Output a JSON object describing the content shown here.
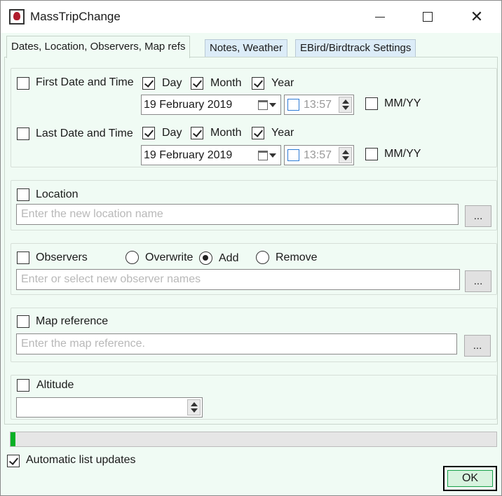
{
  "window": {
    "title": "MassTripChange",
    "background": "#f0fbf4"
  },
  "tabs": [
    {
      "label": "Dates, Location, Observers, Map refs",
      "active": true
    },
    {
      "label": "Notes, Weather",
      "active": false
    },
    {
      "label": "EBird/Birdtrack Settings",
      "active": false
    }
  ],
  "dates": {
    "first": {
      "label": "First Date and Time",
      "checked": false,
      "day_label": "Day",
      "day_checked": true,
      "month_label": "Month",
      "month_checked": true,
      "year_label": "Year",
      "year_checked": true,
      "date_value": "19  February  2019",
      "time_value": "13:57",
      "mmyy_label": "MM/YY",
      "mmyy_checked": false
    },
    "last": {
      "label": "Last Date and Time",
      "checked": false,
      "day_label": "Day",
      "day_checked": true,
      "month_label": "Month",
      "month_checked": true,
      "year_label": "Year",
      "year_checked": true,
      "date_value": "19  February  2019",
      "time_value": "13:57",
      "mmyy_label": "MM/YY",
      "mmyy_checked": false
    }
  },
  "location": {
    "label": "Location",
    "checked": false,
    "placeholder": "Enter the new location name",
    "browse_label": "..."
  },
  "observers": {
    "label": "Observers",
    "checked": false,
    "modes": [
      {
        "label": "Overwrite",
        "selected": false
      },
      {
        "label": "Add",
        "selected": true
      },
      {
        "label": "Remove",
        "selected": false
      }
    ],
    "placeholder": "Enter or select new observer names",
    "browse_label": "..."
  },
  "map_reference": {
    "label": "Map reference",
    "checked": false,
    "placeholder": "Enter the map reference.",
    "browse_label": "..."
  },
  "altitude": {
    "label": "Altitude",
    "checked": false,
    "value": ""
  },
  "progress": {
    "value": 0.002,
    "color": "#06b025"
  },
  "auto_updates": {
    "label": "Automatic list updates",
    "checked": true
  },
  "ok_label": "OK"
}
